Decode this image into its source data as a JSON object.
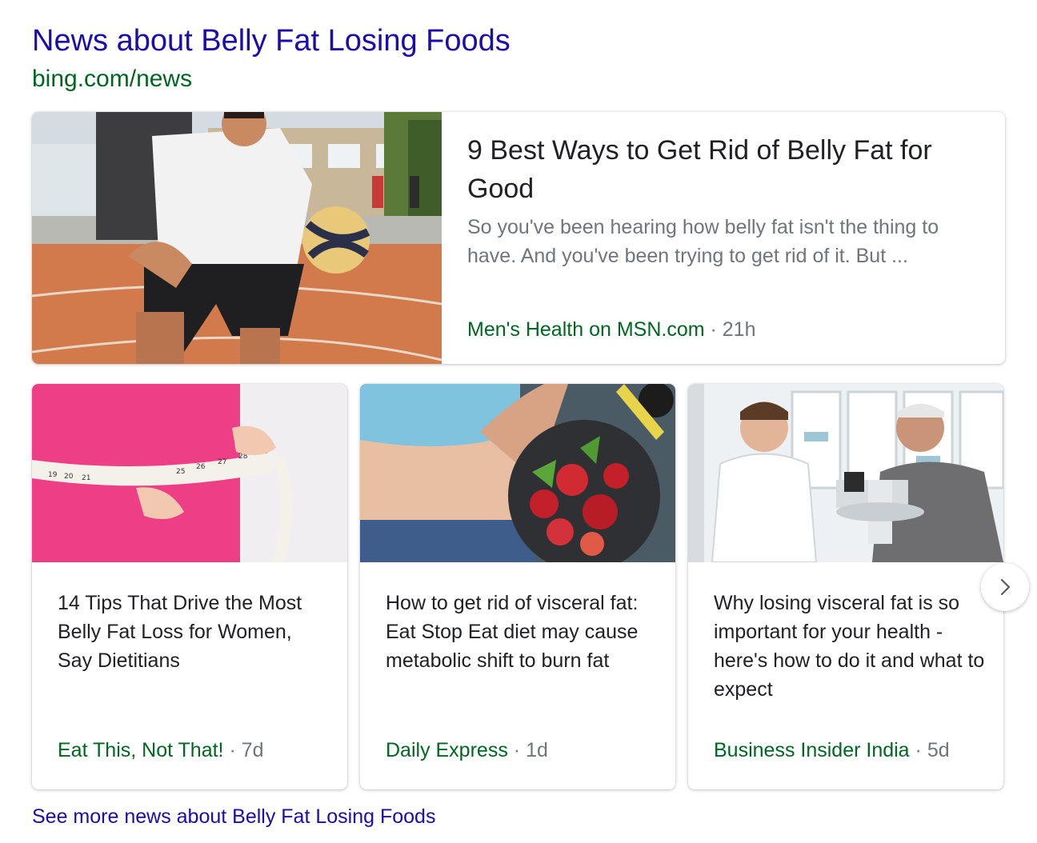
{
  "header": {
    "title": "News about Belly Fat Losing Foods",
    "source": "bing.com/news"
  },
  "featured": {
    "title": "9 Best Ways to Get Rid of Belly Fat for Good",
    "snippet": "So you've been hearing how belly fat isn't the thing to have. And you've been trying to get rid of it. But ...",
    "source": "Men's Health on MSN.com",
    "separator": "·",
    "age": "21h"
  },
  "cards": [
    {
      "title": "14 Tips That Drive the Most Belly Fat Loss for Women, Say Dietitians",
      "source": "Eat This, Not That!",
      "separator": "·",
      "age": "7d"
    },
    {
      "title": "How to get rid of visceral fat: Eat Stop Eat diet may cause metabolic shift to burn fat",
      "source": "Daily Express",
      "separator": "·",
      "age": "1d"
    },
    {
      "title": "Why losing visceral fat is so important for your health - here's how to do it and what to expect",
      "source": "Business Insider India",
      "separator": "·",
      "age": "5d"
    }
  ],
  "see_more": "See more news about Belly Fat Losing Foods",
  "icons": {
    "next": "chevron-right-icon"
  },
  "colors": {
    "link": "#1a0dab",
    "source": "#006621",
    "muted": "#70757a",
    "text": "#202124"
  },
  "tape_numbers": [
    "19",
    "20",
    "21",
    "25",
    "26",
    "27",
    "28",
    "29"
  ]
}
